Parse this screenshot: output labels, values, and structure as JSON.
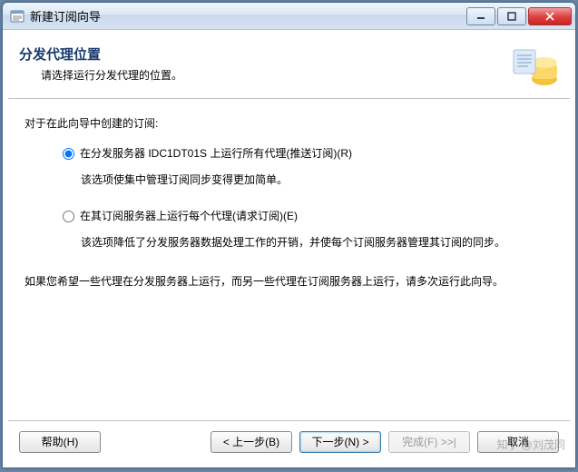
{
  "window": {
    "title": "新建订阅向导"
  },
  "header": {
    "title": "分发代理位置",
    "subtitle": "请选择运行分发代理的位置。"
  },
  "content": {
    "intro": "对于在此向导中创建的订阅:",
    "option1": {
      "label": "在分发服务器 IDC1DT01S 上运行所有代理(推送订阅)(R)",
      "desc": "该选项使集中管理订阅同步变得更加简单。"
    },
    "option2": {
      "label": "在其订阅服务器上运行每个代理(请求订阅)(E)",
      "desc": "该选项降低了分发服务器数据处理工作的开销，并使每个订阅服务器管理其订阅的同步。"
    },
    "footer_note": "如果您希望一些代理在分发服务器上运行，而另一些代理在订阅服务器上运行，请多次运行此向导。"
  },
  "buttons": {
    "help": "帮助(H)",
    "back": "< 上一步(B)",
    "next": "下一步(N) >",
    "finish": "完成(F) >>|",
    "cancel": "取消"
  },
  "watermark": "知乎 @刘茂同"
}
